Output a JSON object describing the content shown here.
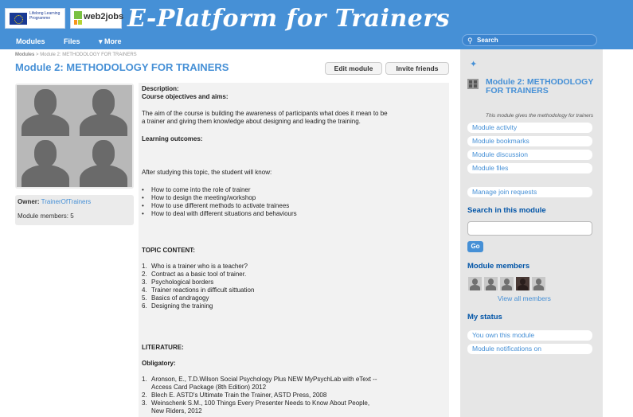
{
  "header": {
    "eu_logo_text": "Lifelong Learning Programme",
    "w2j_logo_text": "web2jobs",
    "site_title": "E-Platform for Trainers",
    "nav": [
      "Modules",
      "Files",
      "▾ More"
    ],
    "search_placeholder": "Search"
  },
  "breadcrumb": {
    "root": "Modules",
    "separator": " > ",
    "current": "Module 2: METHODOLOGY FOR TRAINERS"
  },
  "page": {
    "title": "Module 2: METHODOLOGY FOR TRAINERS",
    "edit_button": "Edit module",
    "invite_button": "Invite friends"
  },
  "owner": {
    "label": "Owner:",
    "name": "TrainerOfTrainers",
    "members_label": "Module members: 5"
  },
  "description": {
    "heading": "Description:",
    "subheading": "Course objectives and aims:",
    "aim_line1": "The aim of the course is building the awareness of participants what does it mean to be",
    "aim_line2": "a trainer and giving them knowledge about designing and leading the training.",
    "outcomes_heading": "Learning outcomes:",
    "outcomes_intro": "After studying this topic, the student will know:",
    "outcomes": [
      "How to come into the role of trainer",
      "How to design the meeting/workshop",
      "How to use different methods to activate trainees",
      "How to deal with different situations and behaviours"
    ],
    "topic_heading": "TOPIC CONTENT:",
    "topics": [
      "Who is a trainer who is a teacher?",
      "Contract as a basic tool of trainer.",
      "Psychological borders",
      "Trainer reactions in difficult sittuation",
      "Basics of andragogy",
      "Designing the training"
    ],
    "literature_heading": "LITERATURE:",
    "obligatory_heading": "Obligatory:",
    "literature": [
      "Aronson, E., T.D.Wilson Social Psychology Plus NEW MyPsychLab with eText --",
      "Access Card Package (8th Edition)  2012",
      "Blech E. ASTD's Ultimate Train the Trainer, ASTD Press, 2008",
      "Weinschenk S.M., 100 Things Every Presenter Needs to Know About People,",
      "New Riders, 2012"
    ]
  },
  "sidebar": {
    "module_title": "Module 2: METHODOLOGY FOR TRAINERS",
    "module_desc": "This module gives the methodology for trainers",
    "links": [
      "Module activity",
      "Module bookmarks",
      "Module discussion",
      "Module files"
    ],
    "manage_requests": "Manage join requests",
    "search_heading": "Search in this module",
    "go_button": "Go",
    "members_heading": "Module members",
    "view_all": "View all members",
    "status_heading": "My status",
    "status_items": [
      "You own this module",
      "Module notifications on"
    ]
  },
  "colors": {
    "brand_blue": "#4690d6",
    "heading_blue": "#0054a7",
    "sidebar_bg": "#e6e6e6"
  }
}
